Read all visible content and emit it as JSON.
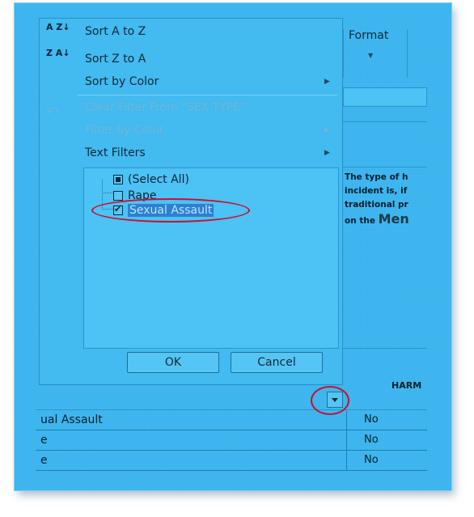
{
  "ribbon": {
    "format_label": "Format"
  },
  "menu": {
    "items": [
      {
        "label": "Sort A to Z",
        "icon": "sort-az-icon"
      },
      {
        "label": "Sort Z to A",
        "icon": "sort-za-icon"
      },
      {
        "label": "Sort by Color",
        "icon": ""
      },
      {
        "label": "Clear Filter From \"SEX TYPE\"",
        "icon": "clear-filter-icon"
      },
      {
        "label": "Filter by Color",
        "icon": ""
      },
      {
        "label": "Text Filters",
        "icon": ""
      }
    ],
    "sort_az_icon_text": "A Z",
    "sort_za_icon_text": "Z A",
    "checklist": [
      {
        "label": "(Select All)",
        "state": "partial"
      },
      {
        "label": "Rape",
        "state": "unchecked"
      },
      {
        "label": "Sexual Assault",
        "state": "checked"
      }
    ],
    "ok_label": "OK",
    "cancel_label": "Cancel"
  },
  "sheet": {
    "note_lines": [
      "The type of h",
      "incident is, if",
      "traditional pr"
    ],
    "note_last_prefix": "on the ",
    "note_last_big": "Men",
    "harm_header": "HARM",
    "rows": [
      {
        "type": "ual Assault",
        "value": "No"
      },
      {
        "type": "e",
        "value": "No"
      },
      {
        "type": "e",
        "value": "No"
      }
    ]
  },
  "colors": {
    "background": "#3fb6ef",
    "highlight": "#c8102e",
    "selection": "#2f7fd0"
  }
}
